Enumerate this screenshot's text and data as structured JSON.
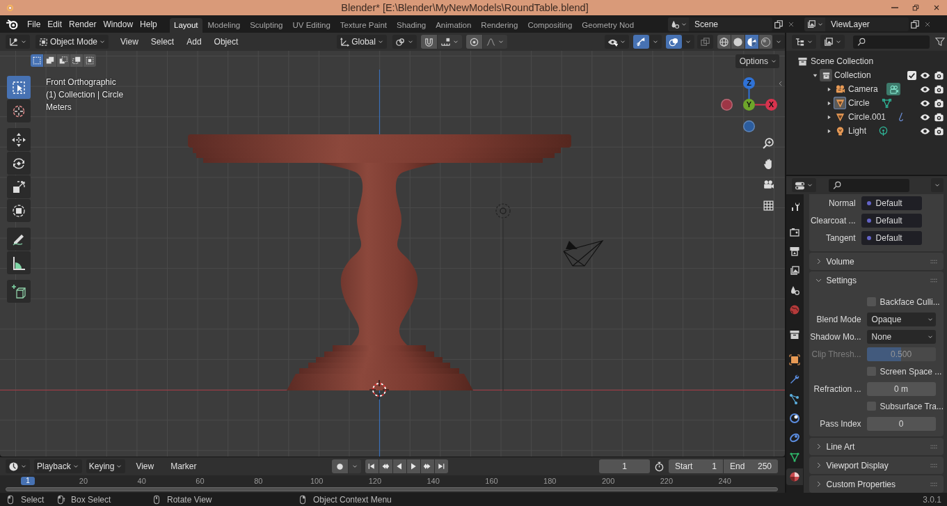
{
  "window": {
    "title": "Blender* [E:\\Blender\\MyNewModels\\RoundTable.blend]"
  },
  "menu_bar": {
    "menus": [
      "File",
      "Edit",
      "Render",
      "Window",
      "Help"
    ],
    "workspaces": [
      {
        "label": "Layout",
        "selected": true
      },
      {
        "label": "Modeling",
        "selected": false
      },
      {
        "label": "Sculpting",
        "selected": false
      },
      {
        "label": "UV Editing",
        "selected": false
      },
      {
        "label": "Texture Paint",
        "selected": false
      },
      {
        "label": "Shading",
        "selected": false
      },
      {
        "label": "Animation",
        "selected": false
      },
      {
        "label": "Rendering",
        "selected": false
      },
      {
        "label": "Compositing",
        "selected": false
      },
      {
        "label": "Geometry Nod",
        "selected": false
      }
    ],
    "scene": "Scene",
    "view_layer": "ViewLayer"
  },
  "viewport": {
    "mode": "Object Mode",
    "menus": [
      "View",
      "Select",
      "Add",
      "Object"
    ],
    "orientation": "Global",
    "gizmos_on": true,
    "overlays_on": true,
    "shading_modes": [
      {
        "kind": "wireframe",
        "selected": false
      },
      {
        "kind": "solid",
        "selected": false
      },
      {
        "kind": "material",
        "selected": true
      },
      {
        "kind": "rendered",
        "selected": false
      }
    ],
    "select_modes": [
      {
        "kind": "set",
        "selected": true
      },
      {
        "kind": "extend",
        "selected": false
      },
      {
        "kind": "subtract",
        "selected": false
      },
      {
        "kind": "invert",
        "selected": false
      },
      {
        "kind": "intersect",
        "selected": false
      }
    ],
    "tools": [
      {
        "kind": "select",
        "selected": true
      },
      {
        "kind": "cursor",
        "selected": false
      },
      {
        "kind": "move",
        "selected": false
      },
      {
        "kind": "rotate",
        "selected": false
      },
      {
        "kind": "scale",
        "selected": false
      },
      {
        "kind": "transform",
        "selected": false
      },
      {
        "kind": "annotate",
        "selected": false
      },
      {
        "kind": "measure",
        "selected": false
      },
      {
        "kind": "add",
        "selected": false
      }
    ],
    "overlay_text": [
      "Front Orthographic",
      "(1) Collection | Circle",
      "Meters"
    ],
    "options": "Options",
    "gizmo_axes": [
      {
        "kind": "negative",
        "color": "#9e3646"
      },
      {
        "kind": "negative",
        "color": "#2c5d9e"
      },
      {
        "kind": "positive",
        "label": "Z",
        "color": "#2f72d6"
      },
      {
        "kind": "positive",
        "label": "X",
        "color": "#d8334e"
      },
      {
        "kind": "positive",
        "label": "Y",
        "color": "#6ea52a"
      }
    ]
  },
  "outliner": {
    "items": [
      {
        "label": "Scene Collection",
        "kind": "scene",
        "children": [
          {
            "label": "Collection",
            "kind": "collection",
            "expanded": true,
            "checked": true,
            "children": [
              {
                "label": "Camera",
                "kind": "camera",
                "expanded": false,
                "active": false,
                "data_active": true
              },
              {
                "label": "Circle",
                "kind": "mesh",
                "expanded": false,
                "active": true,
                "data_active": false
              },
              {
                "label": "Circle.001",
                "kind": "curve",
                "expanded": false,
                "active": false,
                "data_active": false
              },
              {
                "label": "Light",
                "kind": "light",
                "expanded": false,
                "active": false,
                "data_active": false
              }
            ]
          }
        ]
      }
    ]
  },
  "properties": {
    "tabs": [
      {
        "kind": "tool",
        "selected": false
      },
      {
        "kind": "render",
        "selected": false
      },
      {
        "kind": "output",
        "selected": false
      },
      {
        "kind": "view_layer",
        "selected": false
      },
      {
        "kind": "scene",
        "selected": false
      },
      {
        "kind": "world",
        "selected": false
      },
      {
        "kind": "collection",
        "selected": false
      },
      {
        "kind": "object",
        "selected": false
      },
      {
        "kind": "modifiers",
        "selected": false
      },
      {
        "kind": "particles",
        "selected": false
      },
      {
        "kind": "physics",
        "selected": false
      },
      {
        "kind": "constraints",
        "selected": false
      },
      {
        "kind": "data",
        "selected": false
      },
      {
        "kind": "material",
        "selected": true
      }
    ],
    "inputs": [
      {
        "label": "Normal",
        "value": "Default"
      },
      {
        "label": "Clearcoat ...",
        "value": "Default"
      },
      {
        "label": "Tangent",
        "value": "Default"
      }
    ],
    "panels": [
      {
        "title": "Volume",
        "expanded": false
      },
      {
        "title": "Settings",
        "expanded": true,
        "rows": [
          {
            "kind": "checkbox",
            "label": "Backface Culli...",
            "checked": false,
            "disabled": false
          },
          {
            "kind": "dropdown",
            "label": "Blend Mode",
            "value": "Opaque",
            "disabled": false
          },
          {
            "kind": "dropdown",
            "label": "Shadow Mo...",
            "value": "None",
            "disabled": false
          },
          {
            "kind": "slider",
            "label": "Clip Thresh...",
            "value": "0.500",
            "level": 0.5,
            "disabled": true
          },
          {
            "kind": "checkbox",
            "label": "Screen Space ...",
            "checked": false,
            "disabled": false
          },
          {
            "kind": "number",
            "label": "Refraction ...",
            "value": "0 m",
            "disabled": false
          },
          {
            "kind": "checkbox",
            "label": "Subsurface Tra...",
            "checked": false,
            "disabled": false
          },
          {
            "kind": "number",
            "label": "Pass Index",
            "value": "0",
            "disabled": false
          }
        ]
      },
      {
        "title": "Line Art",
        "expanded": false
      },
      {
        "title": "Viewport Display",
        "expanded": false
      },
      {
        "title": "Custom Properties",
        "expanded": false
      }
    ]
  },
  "timeline": {
    "menus": [
      {
        "label": "Playback",
        "kind": "dropdown"
      },
      {
        "label": "Keying",
        "kind": "dropdown"
      },
      {
        "label": "View",
        "kind": "menu"
      },
      {
        "label": "Marker",
        "kind": "menu"
      }
    ],
    "current_frame": "1",
    "start": {
      "label": "Start",
      "value": "1"
    },
    "end": {
      "label": "End",
      "value": "250"
    },
    "playhead": "1",
    "ruler": [
      "20",
      "40",
      "60",
      "80",
      "100",
      "120",
      "140",
      "160",
      "180",
      "200",
      "220",
      "240"
    ]
  },
  "status_bar": {
    "hints": [
      {
        "kind": "left",
        "label": "Select"
      },
      {
        "kind": "drag",
        "label": "Box Select"
      },
      {
        "kind": "middle",
        "label": "Rotate View"
      },
      {
        "kind": "right",
        "label": "Object Context Menu"
      }
    ],
    "version": "3.0.1"
  }
}
